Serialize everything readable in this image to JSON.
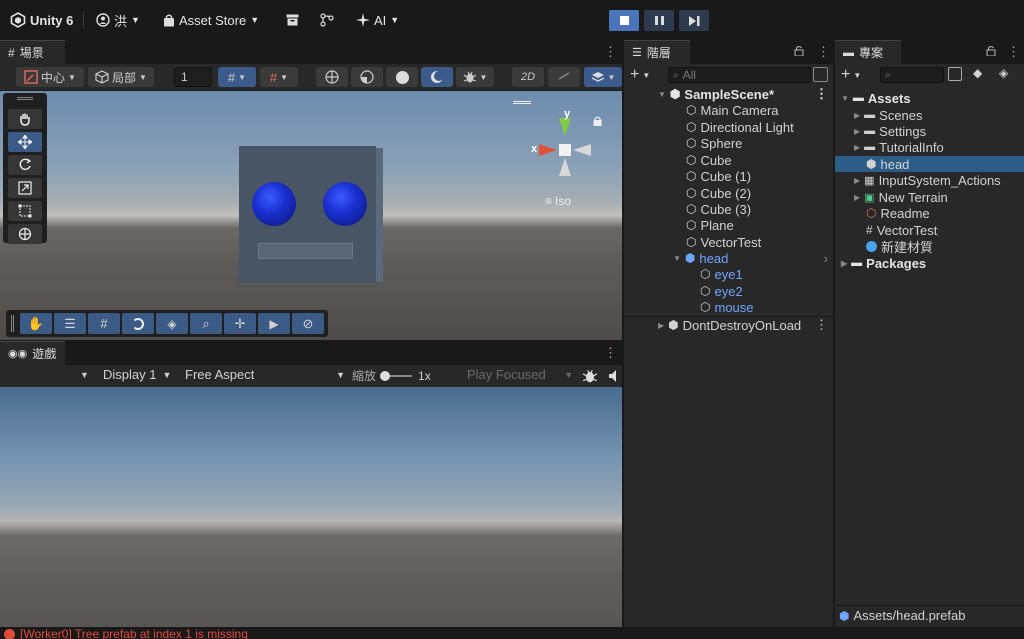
{
  "topbar": {
    "app_name": "Unity 6",
    "account": "洪",
    "asset_store": "Asset Store",
    "ai": "AI"
  },
  "scene": {
    "tab_label": "場景",
    "pivot": "中心",
    "space": "局部",
    "grid_value": "1",
    "iso_label": "Iso",
    "axis_x": "x",
    "axis_y": "y"
  },
  "game": {
    "tab_label": "遊戲",
    "display": "Display 1",
    "aspect": "Free Aspect",
    "scale_label": "縮放",
    "scale_value": "1x",
    "play_mode": "Play Focused"
  },
  "hierarchy": {
    "tab_label": "階層",
    "search_placeholder": "All",
    "scene_name": "SampleScene*",
    "items": [
      {
        "label": "Main Camera"
      },
      {
        "label": "Directional Light"
      },
      {
        "label": "Sphere"
      },
      {
        "label": "Cube"
      },
      {
        "label": "Cube (1)"
      },
      {
        "label": "Cube (2)"
      },
      {
        "label": "Cube (3)"
      },
      {
        "label": "Plane"
      },
      {
        "label": "VectorTest"
      }
    ],
    "prefab": "head",
    "children": [
      {
        "label": "eye1"
      },
      {
        "label": "eye2"
      },
      {
        "label": "mouse"
      }
    ],
    "dont_destroy": "DontDestroyOnLoad"
  },
  "project": {
    "tab_label": "專案",
    "root": "Assets",
    "folders": [
      {
        "label": "Scenes"
      },
      {
        "label": "Settings"
      },
      {
        "label": "TutorialInfo"
      }
    ],
    "files": [
      {
        "label": "head"
      },
      {
        "label": "InputSystem_Actions"
      },
      {
        "label": "New Terrain"
      },
      {
        "label": "Readme"
      },
      {
        "label": "VectorTest"
      },
      {
        "label": "新建材質"
      }
    ],
    "packages": "Packages",
    "footer_path": "Assets/head.prefab"
  },
  "status": {
    "message": "[Worker0] Tree prefab at index 1 is missing"
  },
  "colors": {
    "accent": "#4b75b8",
    "selection": "#2c5d87",
    "prefab_blue": "#6ea6ff",
    "error": "#e04b3a"
  }
}
